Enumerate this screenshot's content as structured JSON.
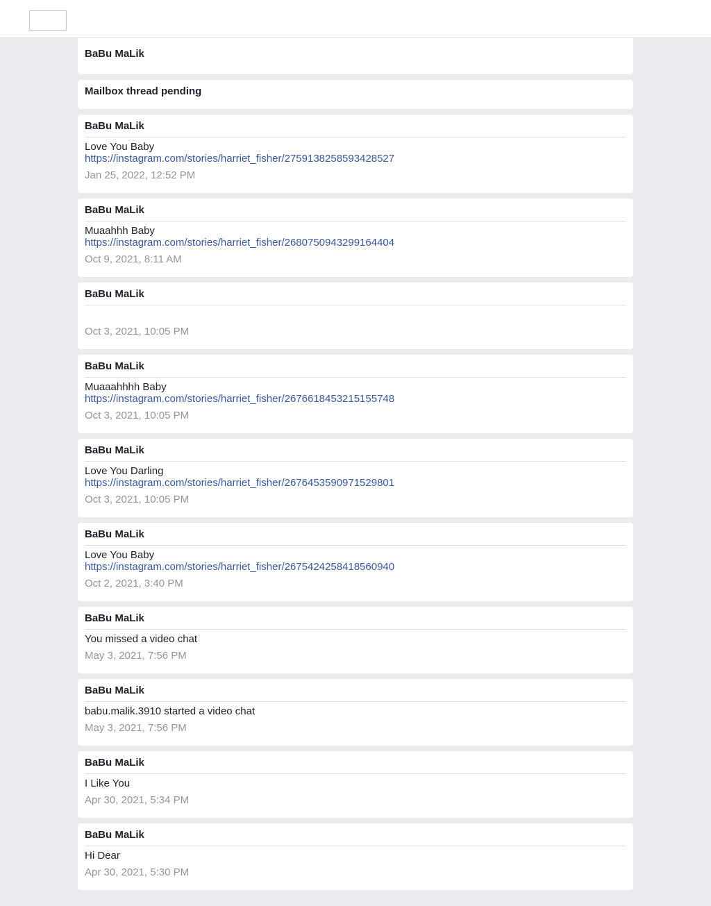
{
  "header": {
    "title": "BaBu MaLik"
  },
  "notice": {
    "text": "Mailbox thread pending"
  },
  "messages": [
    {
      "sender": "BaBu MaLik",
      "text": "Love You Baby",
      "link": "https://instagram.com/stories/harriet_fisher/2759138258593428527",
      "time": "Jan 25, 2022, 12:52 PM"
    },
    {
      "sender": "BaBu MaLik",
      "text": "Muaahhh Baby",
      "link": "https://instagram.com/stories/harriet_fisher/2680750943299164404",
      "time": "Oct 9, 2021, 8:11 AM"
    },
    {
      "sender": "BaBu MaLik",
      "text": "",
      "link": "",
      "time": "Oct 3, 2021, 10:05 PM"
    },
    {
      "sender": "BaBu MaLik",
      "text": "Muaaahhhh Baby",
      "link": "https://instagram.com/stories/harriet_fisher/2676618453215155748",
      "time": "Oct 3, 2021, 10:05 PM"
    },
    {
      "sender": "BaBu MaLik",
      "text": "Love You Darling",
      "link": "https://instagram.com/stories/harriet_fisher/2676453590971529801",
      "time": "Oct 3, 2021, 10:05 PM"
    },
    {
      "sender": "BaBu MaLik",
      "text": "Love You Baby",
      "link": "https://instagram.com/stories/harriet_fisher/2675424258418560940",
      "time": "Oct 2, 2021, 3:40 PM"
    },
    {
      "sender": "BaBu MaLik",
      "text": "You missed a video chat",
      "link": "",
      "time": "May 3, 2021, 7:56 PM"
    },
    {
      "sender": "BaBu MaLik",
      "text": "babu.malik.3910 started a video chat",
      "link": "",
      "time": "May 3, 2021, 7:56 PM"
    },
    {
      "sender": "BaBu MaLik",
      "text": "I Like You",
      "link": "",
      "time": "Apr 30, 2021, 5:34 PM"
    },
    {
      "sender": "BaBu MaLik",
      "text": "Hi Dear",
      "link": "",
      "time": "Apr 30, 2021, 5:30 PM"
    }
  ],
  "colors": {
    "page_background": "#e9ebee",
    "card_background": "#ffffff",
    "link": "#385898",
    "timestamp": "#90949c",
    "divider": "#dddfe2"
  }
}
